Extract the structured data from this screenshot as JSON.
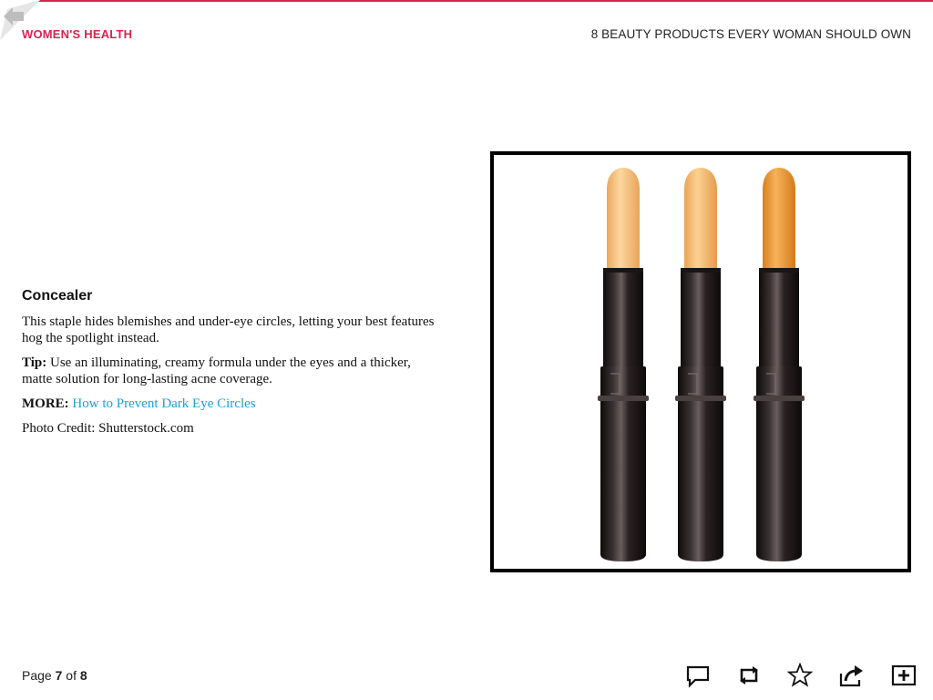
{
  "header": {
    "brand": "WOMEN'S HEALTH",
    "article_title": "8 BEAUTY PRODUCTS EVERY WOMAN SHOULD OWN",
    "accent_color": "#d7254f"
  },
  "slide": {
    "heading": "Concealer",
    "description": "This staple hides blemishes and under-eye circles, letting your best features hog the spotlight instead.",
    "tip_label": "Tip:",
    "tip_text": "Use an illuminating, creamy formula under the eyes and a thicker, matte solution for long-lasting acne coverage.",
    "more_label": "MORE:",
    "more_link": "How to Prevent Dark Eye Circles",
    "link_color": "#1aa0d8",
    "photo_credit": "Photo Credit: Shutterstock.com"
  },
  "image": {
    "subject": "three concealer sticks",
    "shade_colors": [
      "#f5c07e",
      "#f5bd72",
      "#ec9a35"
    ]
  },
  "footer": {
    "page_label": "Page",
    "current_page": "7",
    "of_label": "of",
    "total_pages": "8"
  },
  "toolbar": {
    "icons": [
      "comment-icon",
      "repost-icon",
      "star-icon",
      "share-icon",
      "add-icon"
    ]
  }
}
